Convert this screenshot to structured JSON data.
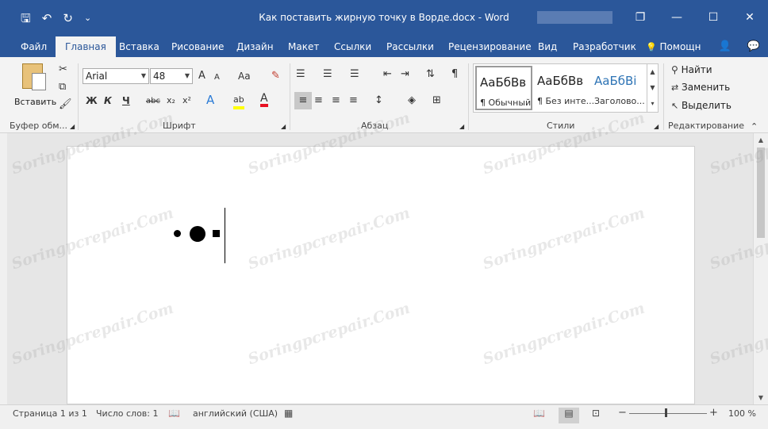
{
  "window": {
    "title": "Как поставить жирную точку в Ворде.docx  -  Word",
    "minimize_glyph": "—",
    "restore_glyph": "❐",
    "maximize_glyph": "☐",
    "close_glyph": "✕"
  },
  "qat": {
    "save_glyph": "🖫",
    "undo_glyph": "↶",
    "redo_glyph": "↻",
    "more_glyph": "⌄"
  },
  "tabs": [
    "Файл",
    "Главная",
    "Вставка",
    "Рисование",
    "Дизайн",
    "Макет",
    "Ссылки",
    "Рассылки",
    "Рецензирование",
    "Вид",
    "Разработчик"
  ],
  "tell_me": "Помощн",
  "tab_icons": {
    "lightbulb": "💡",
    "user": "👤",
    "comment": "💬"
  },
  "ribbon": {
    "clipboard": {
      "paste_label": "Вставить",
      "group_label": "Буфер обм..."
    },
    "font": {
      "font_name": "Arial",
      "font_size": "48",
      "grow": "A",
      "shrink": "A",
      "case": "Aa",
      "bold": "Ж",
      "italic": "К",
      "underline": "Ч",
      "strike": "abc",
      "sub": "x₂",
      "sup": "x²",
      "effects": "A",
      "highlight": "ab",
      "color": "A",
      "group_label": "Шрифт"
    },
    "paragraph": {
      "group_label": "Абзац",
      "pilcrow": "¶"
    },
    "styles": {
      "items": [
        {
          "sample": "АаБбВв",
          "name": "¶ Обычный"
        },
        {
          "sample": "АаБбВв",
          "name": "¶ Без инте..."
        },
        {
          "sample": "АаБбВі",
          "name": "Заголово..."
        }
      ],
      "group_label": "Стили"
    },
    "editing": {
      "find": "Найти",
      "replace": "Заменить",
      "select": "Выделить",
      "group_label": "Редактирование"
    }
  },
  "document": {
    "bullets": [
      {
        "shape": "small-circle"
      },
      {
        "shape": "large-circle"
      },
      {
        "shape": "square"
      }
    ]
  },
  "status": {
    "page": "Страница 1 из 1",
    "words": "Число слов: 1",
    "language": "английский (США)",
    "zoom_minus": "−",
    "zoom_plus": "+",
    "zoom": "100 %"
  },
  "watermark_text": "Soringpcrepair.Com",
  "colors": {
    "title_bar": "#2b579a",
    "ribbon_bg": "#f3f3f3",
    "highlight_yellow": "#ffff00",
    "font_color_red": "#e81123"
  }
}
